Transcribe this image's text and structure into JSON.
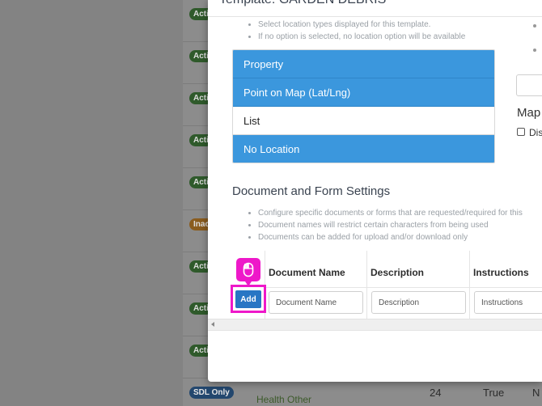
{
  "background": {
    "badges": [
      "Acti",
      "Acti",
      "Acti",
      "Acti",
      "Acti",
      "Inac",
      "Acti",
      "Acti",
      "Acti",
      "SDL Only"
    ],
    "last_row": {
      "number": "24",
      "value": "True",
      "extra": "N",
      "category": "Health Other"
    }
  },
  "modal": {
    "title": "Template: GARDEN DEBRIS",
    "location_hints": [
      "Select location types displayed for this template.",
      "If no option is selected, no location option will be available"
    ],
    "location_options": [
      {
        "label": "Property",
        "selected": true
      },
      {
        "label": "Point on Map (Lat/Lng)",
        "selected": true
      },
      {
        "label": "List",
        "selected": false
      },
      {
        "label": "No Location",
        "selected": true
      }
    ],
    "right_column": {
      "label": "Map",
      "checkbox_label": "Dis"
    },
    "document_section": {
      "title": "Document and Form Settings",
      "hints": [
        "Configure specific documents or forms that are requested/required for this",
        "Document names will restrict certain characters from being used",
        "Documents can be added for upload and/or download only"
      ],
      "columns": [
        "Document Name",
        "Description",
        "Instructions"
      ],
      "add_label": "Add",
      "placeholders": {
        "document_name": "Document Name",
        "description": "Description",
        "instructions": "Instructions"
      }
    }
  },
  "colors": {
    "selected_option": "#3b97dd",
    "add_button": "#2876c4",
    "highlight": "#ee18c9"
  }
}
